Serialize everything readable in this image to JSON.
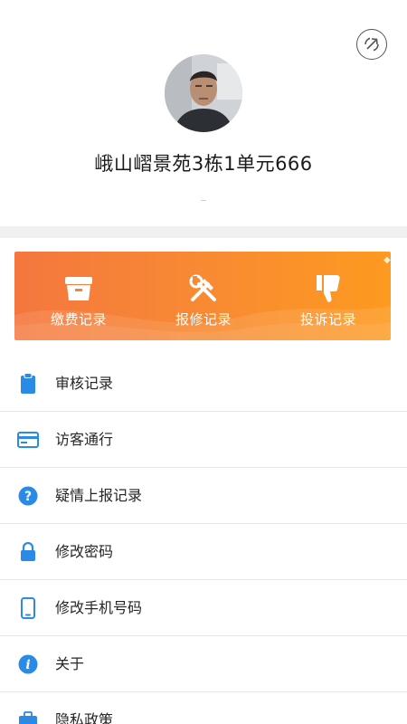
{
  "profile": {
    "address": "峨山嶍景苑3栋1单元666"
  },
  "quick_actions": [
    {
      "label": "缴费记录",
      "icon": "payment-box-icon"
    },
    {
      "label": "报修记录",
      "icon": "repair-tools-icon"
    },
    {
      "label": "投诉记录",
      "icon": "thumbs-down-icon"
    }
  ],
  "menu": [
    {
      "label": "审核记录",
      "icon": "clipboard-icon"
    },
    {
      "label": "访客通行",
      "icon": "card-icon"
    },
    {
      "label": "疑情上报记录",
      "icon": "question-circle-icon"
    },
    {
      "label": "修改密码",
      "icon": "lock-icon"
    },
    {
      "label": "修改手机号码",
      "icon": "phone-icon"
    },
    {
      "label": "关于",
      "icon": "info-icon"
    },
    {
      "label": "隐私政策",
      "icon": "briefcase-icon"
    }
  ],
  "colors": {
    "accent_blue": "#2a8ae6",
    "banner_start": "#f4773e",
    "banner_end": "#fd9a1f"
  }
}
